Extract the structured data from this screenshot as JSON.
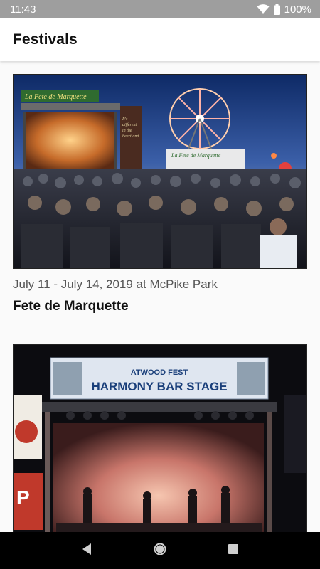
{
  "status_bar": {
    "time": "11:43",
    "battery": "100%"
  },
  "app_bar": {
    "title": "Festivals"
  },
  "festivals": [
    {
      "date": "July 11 - July 14, 2019 at McPike Park",
      "name": "Fete de Marquette",
      "image": {
        "banner": "La Fete de Marquette",
        "sign_lines": [
          "It's",
          "different",
          "in the",
          "heartland."
        ],
        "ferris_sign": "La Fete de Marquette"
      }
    },
    {
      "date": "",
      "name": "",
      "image": {
        "banner_top": "ATWOOD FEST",
        "banner_main": "HARMONY BAR STAGE"
      }
    }
  ],
  "colors": {
    "status_bar": "#9e9e9e",
    "app_bar": "#ffffff",
    "background": "#fafafa",
    "nav_bar": "#000000"
  },
  "icons": {
    "wifi": "wifi-icon",
    "battery": "battery-icon",
    "back": "back-icon",
    "home": "home-icon",
    "recents": "recents-icon"
  }
}
